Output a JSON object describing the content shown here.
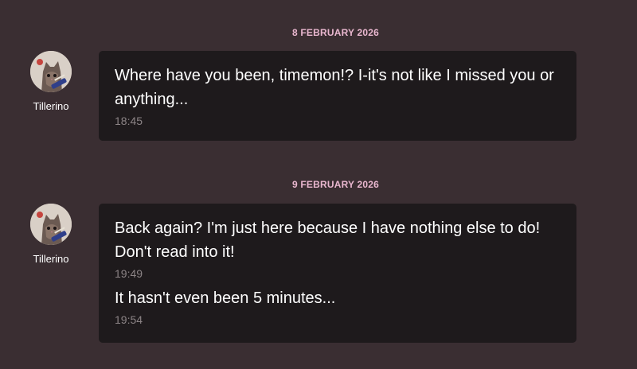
{
  "colors": {
    "background": "#3a2e32",
    "bubble": "#1e1a1c",
    "date_accent": "#e9b7cf",
    "timestamp": "#8c8486"
  },
  "groups": [
    {
      "date": "8 FEBRUARY 2026",
      "sender": {
        "name": "Tillerino",
        "avatar_icon": "cat-avatar-icon"
      },
      "messages": [
        {
          "text": "Where have you been, timemon!? I-it's not like I missed you or anything...",
          "time": "18:45"
        }
      ]
    },
    {
      "date": "9 FEBRUARY 2026",
      "sender": {
        "name": "Tillerino",
        "avatar_icon": "cat-avatar-icon"
      },
      "messages": [
        {
          "text": "Back again? I'm just here because I have nothing else to do! Don't read into it!",
          "time": "19:49"
        },
        {
          "text": "It hasn't even been 5 minutes...",
          "time": "19:54"
        }
      ]
    }
  ]
}
